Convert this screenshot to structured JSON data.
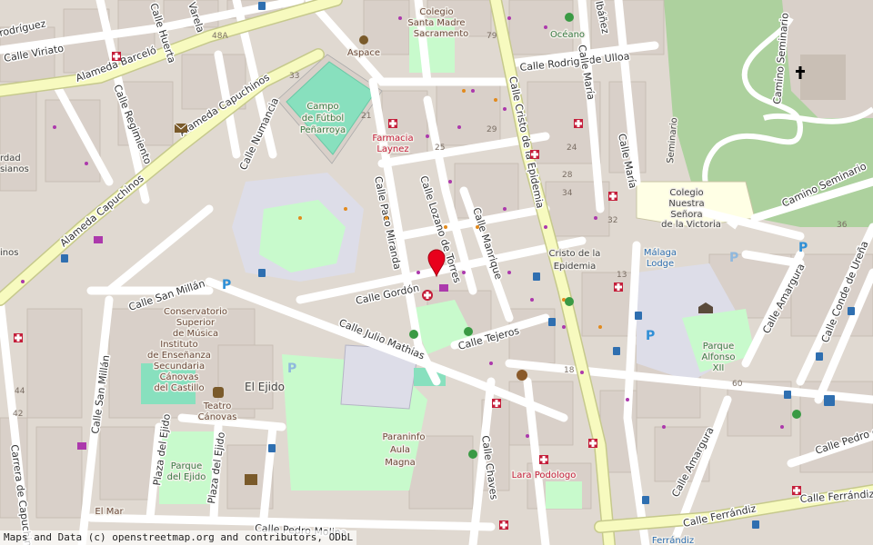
{
  "attribution": "Maps and Data (c) openstreetmap.org and contributors, ODbL",
  "streets": {
    "calle_rodrigo_de_ulloa": "Calle Rodrigo de Ulloa",
    "calle_cristo_de_la_epidemia": "Calle Cristo de la Epidemia",
    "alameda_barcelo": "Alameda Barceló",
    "alameda_capuchinos_upper": "Alameda Capuchinos",
    "alameda_capuchinos_lower": "Alameda Capuchinos",
    "calle_regimiento": "Calle Regimiento",
    "calle_numancia": "Calle Numancia",
    "calle_paco_miranda": "Calle Paco Miranda",
    "calle_lozano_de_torres": "Calle Lozano de Torres",
    "calle_manrique": "Calle Manrique",
    "calle_gordon": "Calle Gordón",
    "calle_julio_mathias": "Calle Julio Mathias",
    "calle_tejeros": "Calle Tejeros",
    "calle_san_millan_h": "Calle San Millán",
    "calle_san_millan_v": "Calle San Millán",
    "carrera_de_capuchinos": "Carrera de Capuchinos",
    "plaza_del_ejido_1": "Plaza del Ejido",
    "plaza_del_ejido_2": "Plaza del Ejido",
    "calle_chaves": "Calle Chaves",
    "calle_maria_1": "Calle María",
    "calle_maria_2": "Calle María",
    "camino_seminario_1": "Camino Seminario",
    "camino_seminario_2": "Camino Seminario",
    "calle_amargura_1": "Calle Amargura",
    "calle_amargura_2": "Calle Amargura",
    "calle_conde_de_urena": "Calle Conde de Ureña",
    "calle_pedro_de": "Calle Pedro de",
    "calle_ferrandiz": "Calle Ferrándiz",
    "calle_ferrandiz_2": "Calle Ferrándiz",
    "calle_pedro_molina": "Calle Pedro Molina",
    "calle_viriato": "Calle Viriato",
    "rodriguez": "rodríguez",
    "calle_huerta": "Calle Huerta",
    "varela": "Varela",
    "ibanez": "Ibáñez"
  },
  "pois": {
    "colegio_santa_madre": [
      "Colegio",
      "Santa Madre",
      "Sacramento"
    ],
    "aspace": "Aspace",
    "oceano": "Océano",
    "campo_futbol": [
      "Campo",
      "de Fútbol",
      "Peñarroya"
    ],
    "farmacia_laynez": [
      "Farmacia",
      "Laynez"
    ],
    "colegio_nuestra_senora": [
      "Colegio",
      "Nuestra",
      "Señora",
      "de la Victoria"
    ],
    "cristo_epidemia": [
      "Cristo de la",
      "Epidemia"
    ],
    "malaga_lodge": [
      "Málaga",
      "Lodge"
    ],
    "conservatorio": [
      "Conservatorio",
      "Superior",
      "de Música"
    ],
    "instituto": [
      "Instituto",
      "de Enseñanza",
      "Secundaria",
      "Cánovas",
      "del Castillo"
    ],
    "teatro_canovas": [
      "Teatro",
      "Cánovas"
    ],
    "el_ejido": "El Ejido",
    "paraninfo": [
      "Paraninfo",
      "Aula",
      "Magna"
    ],
    "parque_alfonso": [
      "Parque",
      "Alfonso",
      "XII"
    ],
    "parque_del_ejido": [
      "Parque",
      "del Ejido"
    ],
    "lara_podologo": "Lara Podologo",
    "el_mar": "El Mar",
    "seminario": "Seminario",
    "ferrandiz": "Ferrándiz",
    "left_edge_a": "rdad",
    "left_edge_b": "sianos",
    "left_edge_c": "inos"
  },
  "house_numbers": {
    "n_48a": "48A",
    "n_79": "79",
    "n_33": "33",
    "n_21": "21",
    "n_25": "25",
    "n_29": "29",
    "n_24": "24",
    "n_34": "34",
    "n_28": "28",
    "n_32": "32",
    "n_13": "13",
    "n_44": "44",
    "n_42": "42",
    "n_18": "18",
    "n_36": "36",
    "n_60": "60"
  },
  "colors": {
    "background": "#e0d9d1",
    "building": "#d9d0c9",
    "road_major": "#f7fabf",
    "road_major_casing": "#c6c98c",
    "road_minor": "#ffffff",
    "park": "#c8facc",
    "forest": "#add19e",
    "pitch": "#88e0be",
    "school": "#ffffe5",
    "pedestrian": "#dddde8",
    "marker": "#e8001c",
    "pharmacy": "#c41e3a",
    "bus": "#2f6fb0",
    "brown_poi": "#7a5a2a"
  },
  "icons": {
    "marker": "map-pin-icon",
    "pharmacy": "pharmacy-cross-icon",
    "bus": "bus-stop-icon",
    "parking": "parking-icon",
    "church": "church-cross-icon",
    "post": "post-office-icon",
    "theatre": "theatre-icon",
    "library": "library-icon",
    "museum": "museum-icon",
    "playground": "playground-icon",
    "shop": "shop-icon",
    "hospital": "hospital-icon"
  }
}
